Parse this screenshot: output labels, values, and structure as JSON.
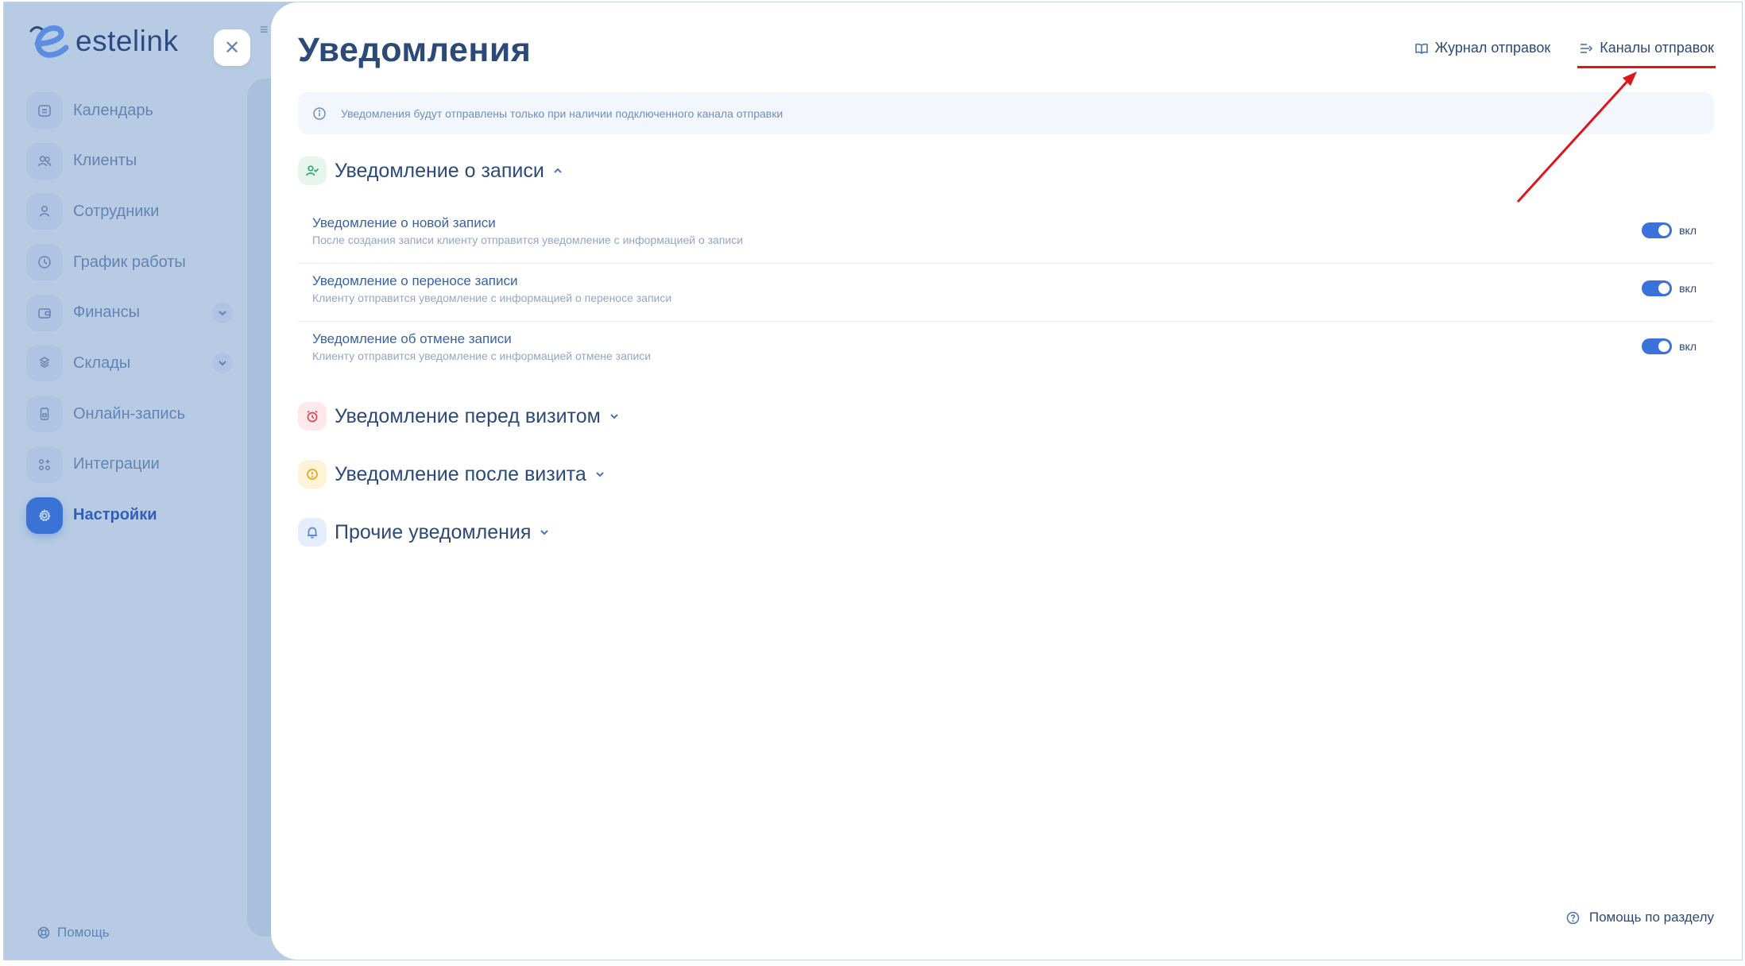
{
  "app": {
    "name": "estelink"
  },
  "sidebar": {
    "items": [
      {
        "label": "Календарь",
        "icon": "calendar-icon",
        "has_chevron": false,
        "active": false
      },
      {
        "label": "Клиенты",
        "icon": "clients-icon",
        "has_chevron": false,
        "active": false
      },
      {
        "label": "Сотрудники",
        "icon": "user-icon",
        "has_chevron": false,
        "active": false
      },
      {
        "label": "График работы",
        "icon": "clock-icon",
        "has_chevron": false,
        "active": false
      },
      {
        "label": "Финансы",
        "icon": "wallet-icon",
        "has_chevron": true,
        "active": false
      },
      {
        "label": "Склады",
        "icon": "boxes-icon",
        "has_chevron": true,
        "active": false
      },
      {
        "label": "Онлайн-запись",
        "icon": "phone-icon",
        "has_chevron": false,
        "active": false
      },
      {
        "label": "Интеграции",
        "icon": "grid-plus-icon",
        "has_chevron": false,
        "active": false
      },
      {
        "label": "Настройки",
        "icon": "gear-icon",
        "has_chevron": false,
        "active": true
      }
    ],
    "help_label": "Помощь"
  },
  "modal": {
    "title": "Уведомления",
    "links": {
      "journal": "Журнал отправок",
      "channels": "Каналы отправок"
    },
    "info_text": "Уведомления будут отправлены только при наличии подключенного канала отправки",
    "sections": {
      "booking": {
        "title": "Уведомление о записи",
        "expanded": true,
        "rows": [
          {
            "title": "Уведомление о новой записи",
            "desc": "После создания записи клиенту отправится уведомление с информацией о записи",
            "toggle": "вкл"
          },
          {
            "title": "Уведомление о переносе записи",
            "desc": "Клиенту отправится уведомление с информацией о переносе записи",
            "toggle": "вкл"
          },
          {
            "title": "Уведомление об отмене записи",
            "desc": "Клиенту отправится уведомление с информацией отмене записи",
            "toggle": "вкл"
          }
        ]
      },
      "before_visit": {
        "title": "Уведомление перед визитом",
        "expanded": false
      },
      "after_visit": {
        "title": "Уведомление после визита",
        "expanded": false
      },
      "other": {
        "title": "Прочие уведомления",
        "expanded": false
      }
    },
    "help_section": "Помощь по разделу"
  },
  "colors": {
    "accent": "#3b72d9",
    "annotation": "#e0141b",
    "sidebar_bg": "#b7cce4",
    "title": "#2b4a78"
  }
}
